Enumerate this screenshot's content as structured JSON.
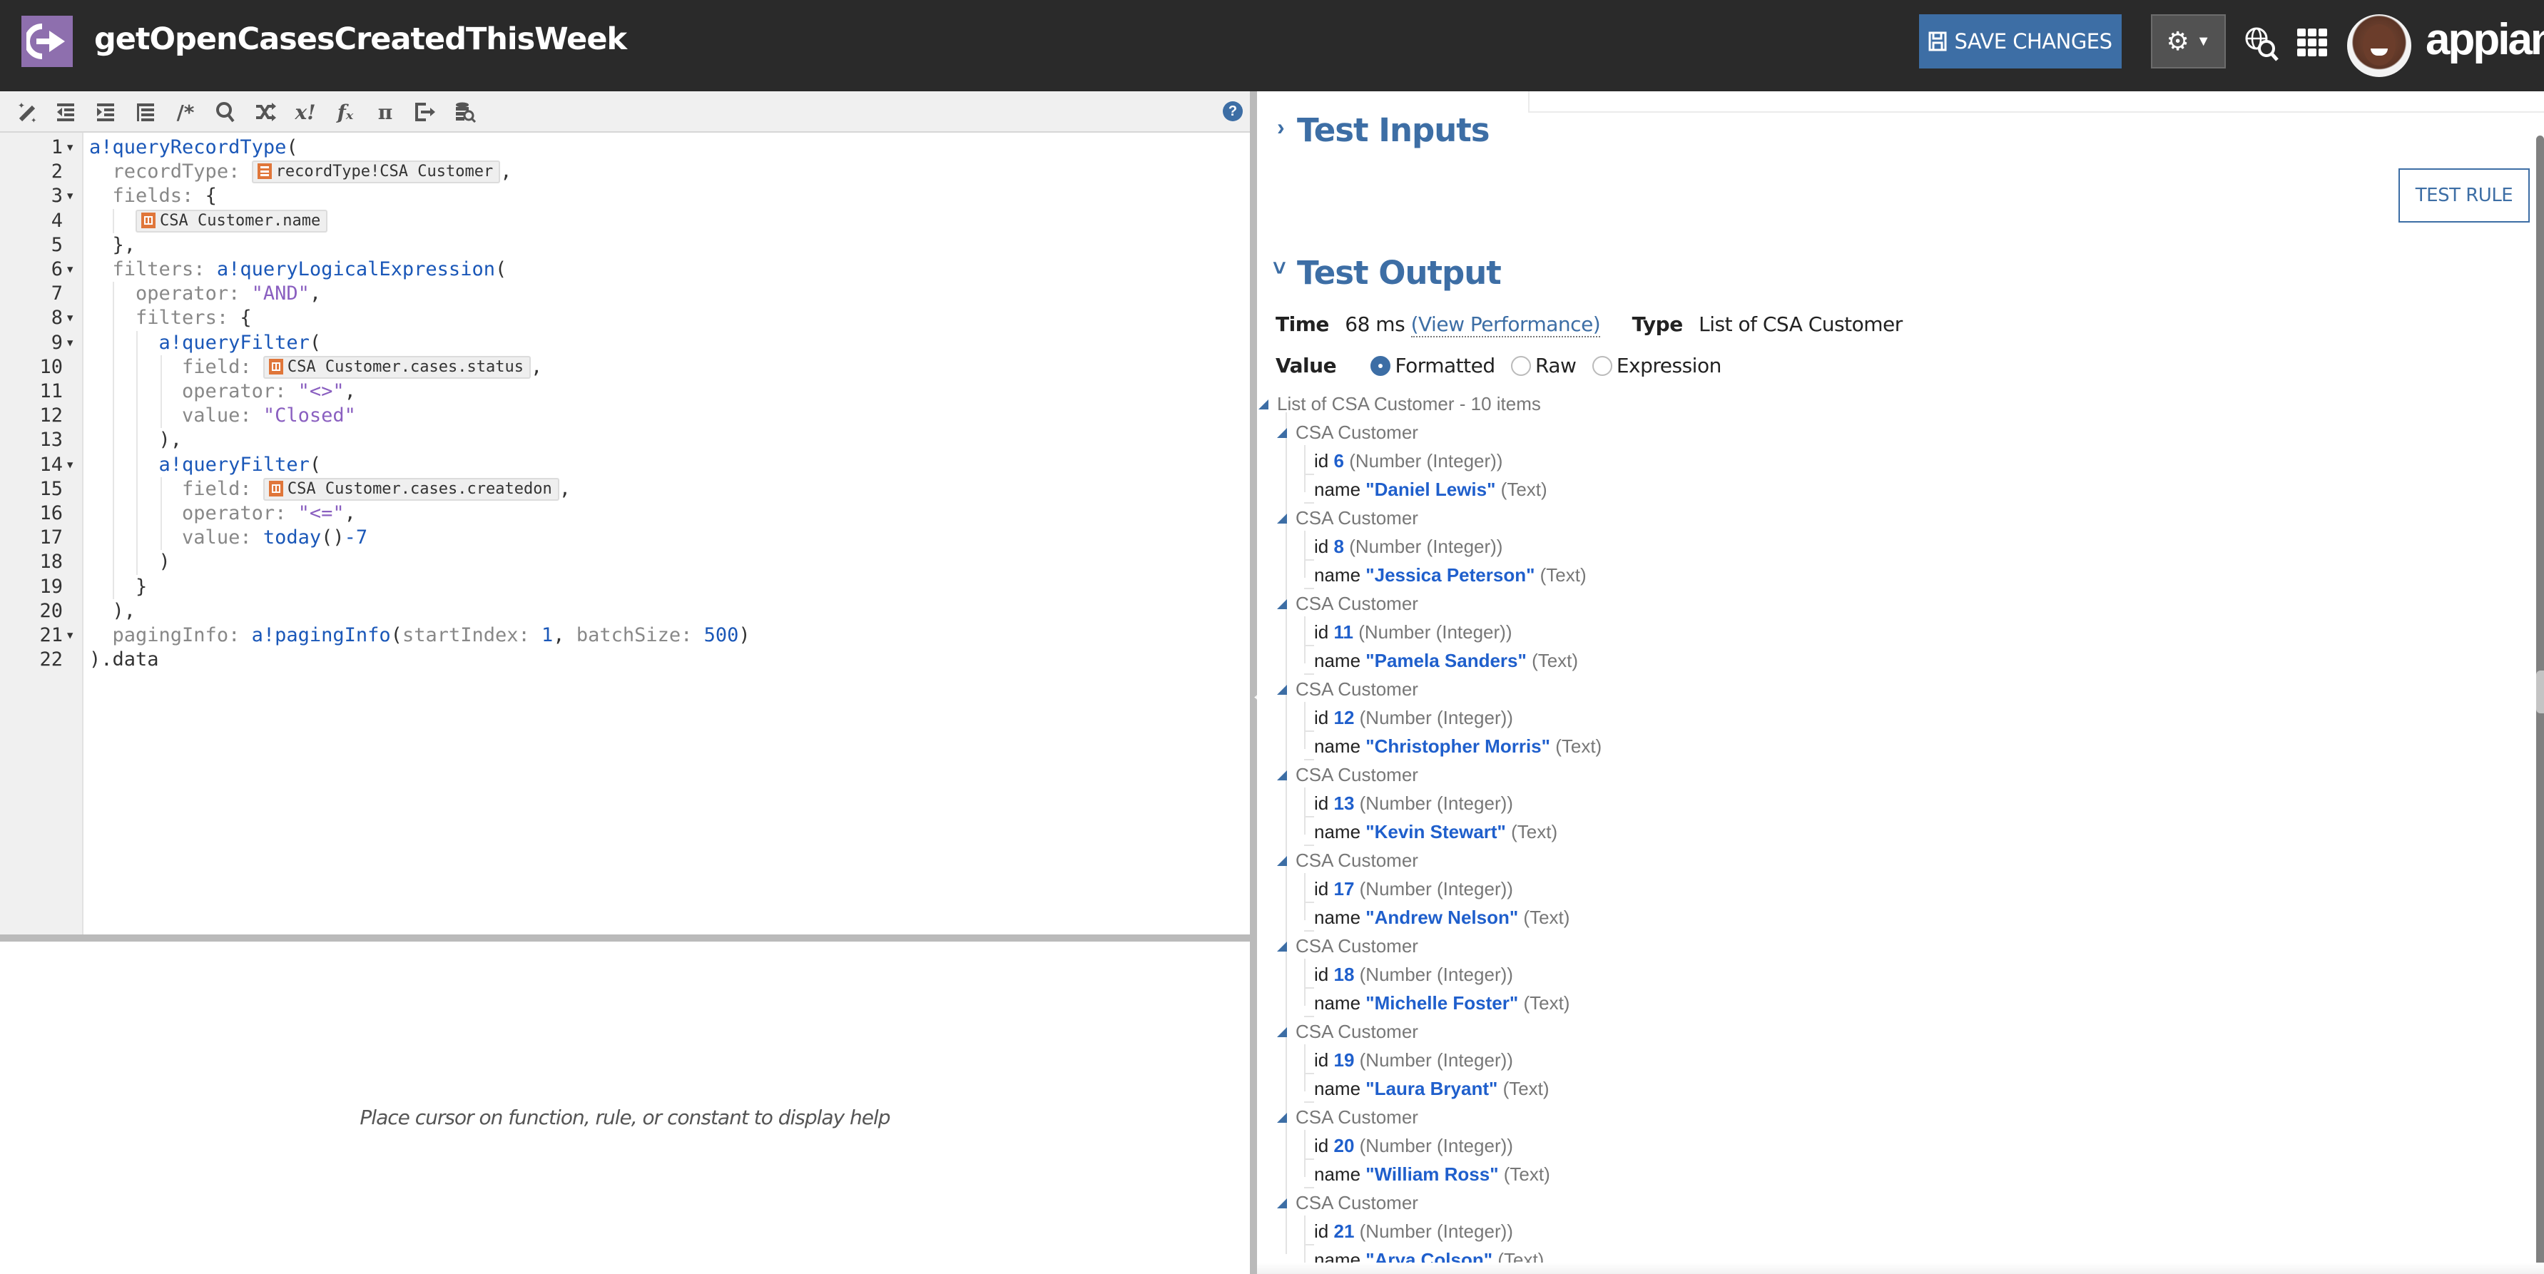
{
  "header": {
    "app_icon": "expression-rule-icon",
    "title": "getOpenCasesCreatedThisWeek",
    "save_label": "SAVE CHANGES",
    "save_icon": "floppy-disk-icon",
    "settings_icon": "gear-icon",
    "settings_caret": "caret-down-icon",
    "search_icon": "globe-search-icon",
    "apps_icon": "app-grid-icon",
    "avatar": "user-avatar",
    "brand": "appian"
  },
  "toolbar": {
    "buttons": [
      {
        "name": "format-expression",
        "icon": "magic-wand-icon"
      },
      {
        "name": "outdent",
        "icon": "outdent-icon"
      },
      {
        "name": "indent",
        "icon": "indent-icon"
      },
      {
        "name": "auto-indent",
        "icon": "list-indent-icon"
      },
      {
        "name": "comment",
        "icon": "comment-icon",
        "glyph": "/*"
      },
      {
        "name": "search",
        "icon": "search-icon"
      },
      {
        "name": "random",
        "icon": "shuffle-icon"
      },
      {
        "name": "variables",
        "icon": "variable-icon",
        "glyph": "x!"
      },
      {
        "name": "functions",
        "icon": "function-icon",
        "glyph": "fₓ"
      },
      {
        "name": "constants",
        "icon": "pi-icon",
        "glyph": "π"
      },
      {
        "name": "export",
        "icon": "export-icon"
      },
      {
        "name": "query-data",
        "icon": "database-search-icon"
      }
    ],
    "help_icon": "help-icon",
    "help_glyph": "?"
  },
  "editor": {
    "lines": [
      {
        "n": "1",
        "fold": true
      },
      {
        "n": "2",
        "fold": false
      },
      {
        "n": "3",
        "fold": true
      },
      {
        "n": "4",
        "fold": false
      },
      {
        "n": "5",
        "fold": false
      },
      {
        "n": "6",
        "fold": true
      },
      {
        "n": "7",
        "fold": false
      },
      {
        "n": "8",
        "fold": true
      },
      {
        "n": "9",
        "fold": true
      },
      {
        "n": "10",
        "fold": false
      },
      {
        "n": "11",
        "fold": false
      },
      {
        "n": "12",
        "fold": false
      },
      {
        "n": "13",
        "fold": false
      },
      {
        "n": "14",
        "fold": true
      },
      {
        "n": "15",
        "fold": false
      },
      {
        "n": "16",
        "fold": false
      },
      {
        "n": "17",
        "fold": false
      },
      {
        "n": "18",
        "fold": false
      },
      {
        "n": "19",
        "fold": false
      },
      {
        "n": "20",
        "fold": false
      },
      {
        "n": "21",
        "fold": true
      },
      {
        "n": "22",
        "fold": false
      }
    ],
    "tokens": {
      "queryRecordType": "a!queryRecordType",
      "open_paren": "(",
      "recordType_key": "recordType:",
      "recordType_token": "recordType!CSA Customer",
      "comma": ",",
      "fields_key": "fields:",
      "open_brace": "{",
      "field_name_token": "CSA Customer.name",
      "close_brace_comma": "},",
      "filters_key": "filters:",
      "queryLogicalExpression": "a!queryLogicalExpression",
      "operator_key": "operator:",
      "and_str": "\"AND\"",
      "queryFilter": "a!queryFilter",
      "field_key": "field:",
      "status_token": "CSA Customer.cases.status",
      "neq_str": "\"<>\"",
      "value_key": "value:",
      "closed_str": "\"Closed\"",
      "close_paren_comma": "),",
      "createdon_token": "CSA Customer.cases.createdon",
      "lte_str": "\"<=\"",
      "today_fn": "today",
      "today_args": "()",
      "minus": "-",
      "seven": "7",
      "close_paren": ")",
      "close_brace": "}",
      "pagingInfo_key": "pagingInfo:",
      "pagingInfo_fn": "a!pagingInfo",
      "startIndex_key": "startIndex:",
      "one": "1",
      "batchSize_key": "batchSize:",
      "five_hundred": "500",
      "data_suffix": ").data"
    }
  },
  "help_panel": {
    "message": "Place cursor on function, rule, or constant to display help"
  },
  "splitter": {
    "collapse_icon": "arrow-left-icon",
    "glyph": "←"
  },
  "right_panel": {
    "test_inputs": {
      "title": "Test Inputs",
      "expanded": false,
      "chevron": "›"
    },
    "test_rule_label": "TEST RULE",
    "test_output": {
      "title": "Test Output",
      "expanded": true,
      "chevron": "˅",
      "time_label": "Time",
      "time_value": "68 ms",
      "view_performance": "(View Performance)",
      "type_label": "Type",
      "type_value": "List of CSA Customer",
      "value_label": "Value",
      "value_modes": [
        {
          "label": "Formatted",
          "selected": true
        },
        {
          "label": "Raw",
          "selected": false
        },
        {
          "label": "Expression",
          "selected": false
        }
      ],
      "root_label": "List of CSA Customer - 10 items",
      "item_label": "CSA Customer",
      "id_key": "id",
      "name_key": "name",
      "id_type": "(Number (Integer))",
      "name_type": "(Text)",
      "items": [
        {
          "id": "6",
          "name": "\"Daniel Lewis\""
        },
        {
          "id": "8",
          "name": "\"Jessica Peterson\""
        },
        {
          "id": "11",
          "name": "\"Pamela Sanders\""
        },
        {
          "id": "12",
          "name": "\"Christopher Morris\""
        },
        {
          "id": "13",
          "name": "\"Kevin Stewart\""
        },
        {
          "id": "17",
          "name": "\"Andrew Nelson\""
        },
        {
          "id": "18",
          "name": "\"Michelle Foster\""
        },
        {
          "id": "19",
          "name": "\"Laura Bryant\""
        },
        {
          "id": "20",
          "name": "\"William Ross\""
        },
        {
          "id": "21",
          "name": "\"Arya Colson\""
        }
      ]
    }
  },
  "colors": {
    "header_bg": "#2a2a2a",
    "accent": "#3d6ea5",
    "app_icon_bg": "#8e6fae",
    "token_icon": "#e0763a",
    "value_blue": "#1f5fcc",
    "string_purple": "#8a5fc0"
  }
}
